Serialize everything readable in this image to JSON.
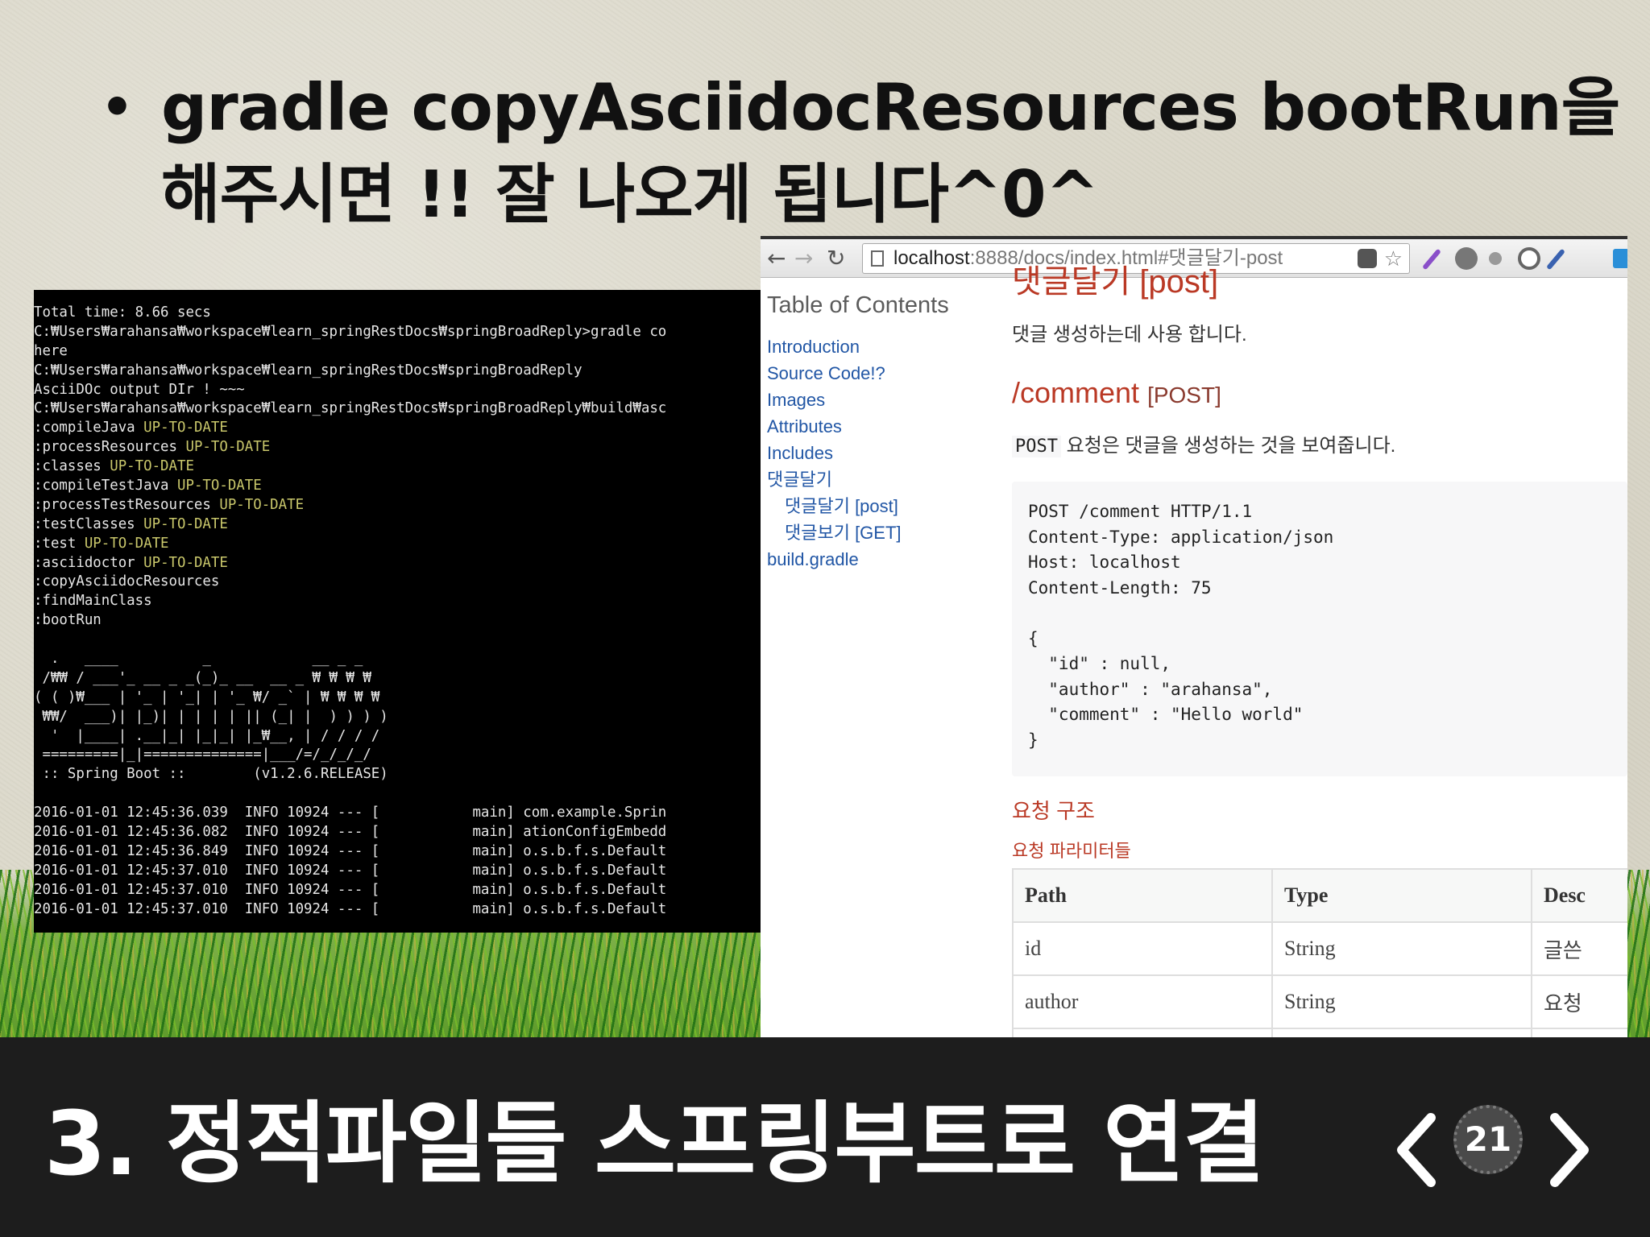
{
  "slide": {
    "title_line1": "gradle copyAsciidocResources bootRun을",
    "title_line2": "해주시면 !! 잘 나오게 됩니다^0^",
    "bullet": "•",
    "footer_title": "3. 정적파일들 스프링부트로 연결",
    "page_number": "21"
  },
  "terminal": {
    "lines": [
      {
        "text": "Total time: 8.66 secs",
        "status": ""
      },
      {
        "text": "C:₩Users₩arahansa₩workspace₩learn_springRestDocs₩springBroadReply>gradle co",
        "status": ""
      },
      {
        "text": "here",
        "status": ""
      },
      {
        "text": "C:₩Users₩arahansa₩workspace₩learn_springRestDocs₩springBroadReply",
        "status": ""
      },
      {
        "text": "AsciiDOc output DIr ! ~~~",
        "status": ""
      },
      {
        "text": "C:₩Users₩arahansa₩workspace₩learn_springRestDocs₩springBroadReply₩build₩asc",
        "status": ""
      },
      {
        "text": ":compileJava ",
        "status": "UP-TO-DATE"
      },
      {
        "text": ":processResources ",
        "status": "UP-TO-DATE"
      },
      {
        "text": ":classes ",
        "status": "UP-TO-DATE"
      },
      {
        "text": ":compileTestJava ",
        "status": "UP-TO-DATE"
      },
      {
        "text": ":processTestResources ",
        "status": "UP-TO-DATE"
      },
      {
        "text": ":testClasses ",
        "status": "UP-TO-DATE"
      },
      {
        "text": ":test ",
        "status": "UP-TO-DATE"
      },
      {
        "text": ":asciidoctor ",
        "status": "UP-TO-DATE"
      },
      {
        "text": ":copyAsciidocResources",
        "status": ""
      },
      {
        "text": ":findMainClass",
        "status": ""
      },
      {
        "text": ":bootRun",
        "status": ""
      },
      {
        "text": "",
        "status": ""
      },
      {
        "text": "  .   ____          _            __ _ _",
        "status": ""
      },
      {
        "text": " /₩₩ / ___'_ __ _ _(_)_ __  __ _ ₩ ₩ ₩ ₩",
        "status": ""
      },
      {
        "text": "( ( )₩___ | '_ | '_| | '_ ₩/ _` | ₩ ₩ ₩ ₩",
        "status": ""
      },
      {
        "text": " ₩₩/  ___)| |_)| | | | | || (_| |  ) ) ) )",
        "status": ""
      },
      {
        "text": "  '  |____| .__|_| |_|_| |_₩__, | / / / /",
        "status": ""
      },
      {
        "text": " =========|_|==============|___/=/_/_/_/",
        "status": ""
      },
      {
        "text": " :: Spring Boot ::        (v1.2.6.RELEASE)",
        "status": ""
      },
      {
        "text": "",
        "status": ""
      },
      {
        "text": "2016-01-01 12:45:36.039  INFO 10924 --- [           main] com.example.Sprin",
        "status": ""
      },
      {
        "text": "2016-01-01 12:45:36.082  INFO 10924 --- [           main] ationConfigEmbedd",
        "status": ""
      },
      {
        "text": "2016-01-01 12:45:36.849  INFO 10924 --- [           main] o.s.b.f.s.Default",
        "status": ""
      },
      {
        "text": "2016-01-01 12:45:37.010  INFO 10924 --- [           main] o.s.b.f.s.Default",
        "status": ""
      },
      {
        "text": "2016-01-01 12:45:37.010  INFO 10924 --- [           main] o.s.b.f.s.Default",
        "status": ""
      },
      {
        "text": "2016-01-01 12:45:37.010  INFO 10924 --- [           main] o.s.b.f.s.Default",
        "status": ""
      }
    ]
  },
  "browser": {
    "url_host": "localhost",
    "url_rest": ":8888/docs/index.html#댓글달기-post",
    "toc": {
      "title": "Table of Contents",
      "items": [
        {
          "label": "Introduction",
          "sub": false
        },
        {
          "label": "Source Code!?",
          "sub": false
        },
        {
          "label": "Images",
          "sub": false
        },
        {
          "label": "Attributes",
          "sub": false
        },
        {
          "label": "Includes",
          "sub": false
        },
        {
          "label": "댓글달기",
          "sub": false
        },
        {
          "label": "댓글달기 [post]",
          "sub": true
        },
        {
          "label": "댓글보기 [GET]",
          "sub": true
        },
        {
          "label": "build.gradle",
          "sub": false
        }
      ]
    },
    "content": {
      "heading_partial": "댓글달기 [post]",
      "para1": "댓글 생성하는데 사용 합니다.",
      "section_path": "/comment",
      "section_method": "[POST]",
      "para2_code": "POST",
      "para2_text": " 요청은 댓글을 생성하는 것을 보여줍니다.",
      "listing": [
        "POST /comment HTTP/1.1",
        "Content-Type: application/json",
        "Host: localhost",
        "Content-Length: 75",
        "",
        "{",
        "  \"id\" : null,",
        "  \"author\" : \"arahansa\",",
        "  \"comment\" : \"Hello world\"",
        "}"
      ],
      "struct_heading": "요청 구조",
      "params_heading": "요청 파라미터들",
      "table": {
        "headers": [
          "Path",
          "Type",
          "Desc"
        ],
        "rows": [
          [
            "id",
            "String",
            "글쓴"
          ],
          [
            "author",
            "String",
            "요청"
          ]
        ]
      }
    }
  }
}
